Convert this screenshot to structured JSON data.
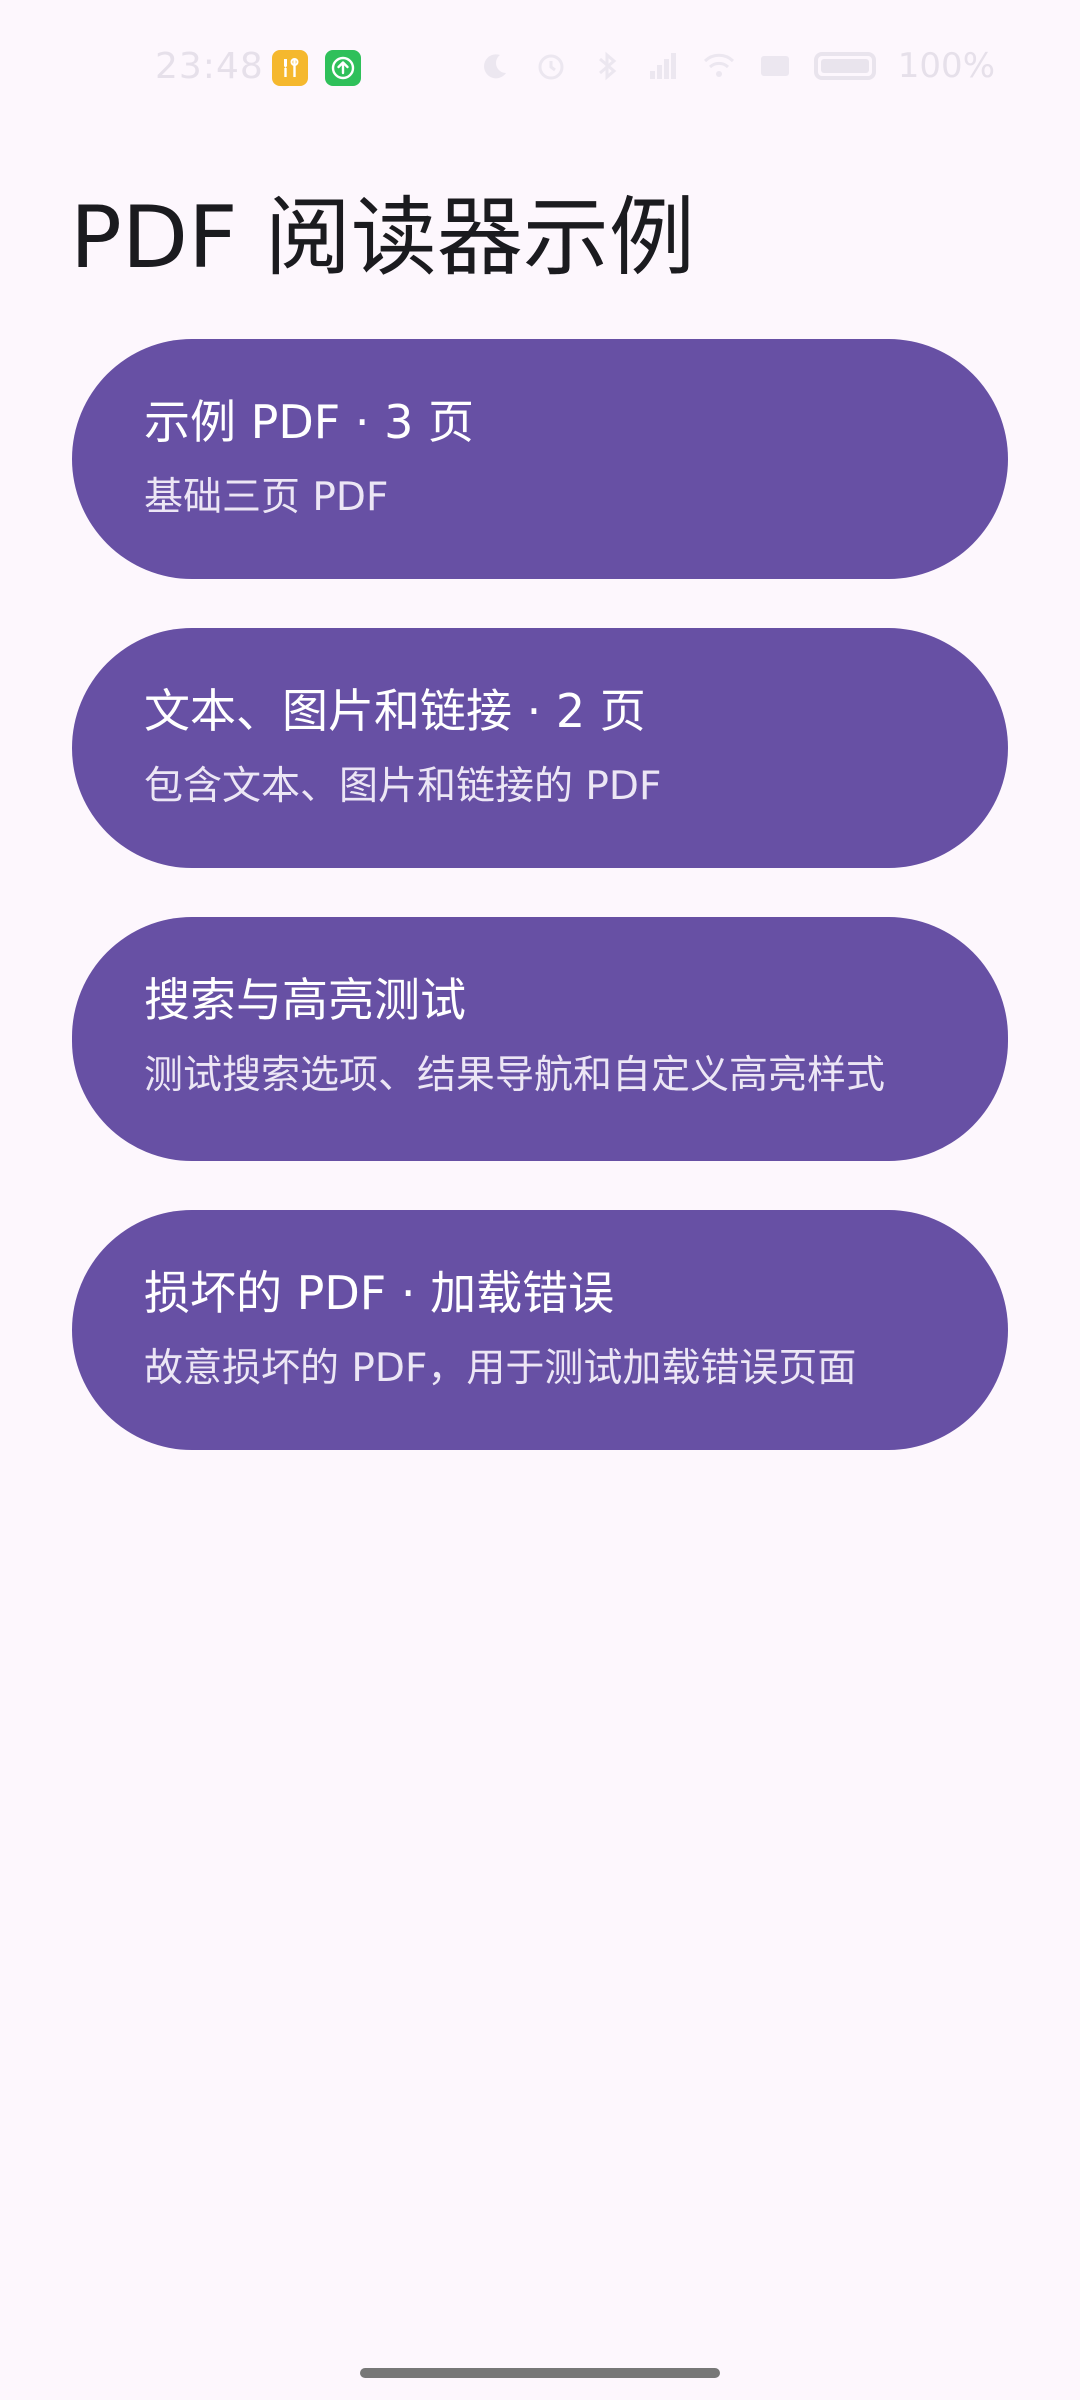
{
  "status_bar": {
    "time": "23:48",
    "battery": "100%",
    "icons": [
      "moon-icon",
      "alarm-icon",
      "bluetooth-icon",
      "sim-signal-icon",
      "wifi-icon",
      "screen-cast-icon",
      "battery-icon"
    ],
    "notifications": [
      "tools-app-icon",
      "upload-icon"
    ]
  },
  "header": {
    "title": "PDF 阅读器示例"
  },
  "cards": [
    {
      "title": "示例 PDF · 3 页",
      "subtitle": "基础三页 PDF"
    },
    {
      "title": "文本、图片和链接 · 2 页",
      "subtitle": "包含文本、图片和链接的 PDF"
    },
    {
      "title": "搜索与高亮测试",
      "subtitle": "测试搜索选项、结果导航和自定义高亮样式"
    },
    {
      "title": "损坏的 PDF · 加载错误",
      "subtitle": "故意损坏的 PDF，用于测试加载错误页面"
    }
  ],
  "colors": {
    "background": "#fdf7fd",
    "card": "#6750a4",
    "card_text": "#ffffff",
    "title_text": "#1b1b1f"
  }
}
